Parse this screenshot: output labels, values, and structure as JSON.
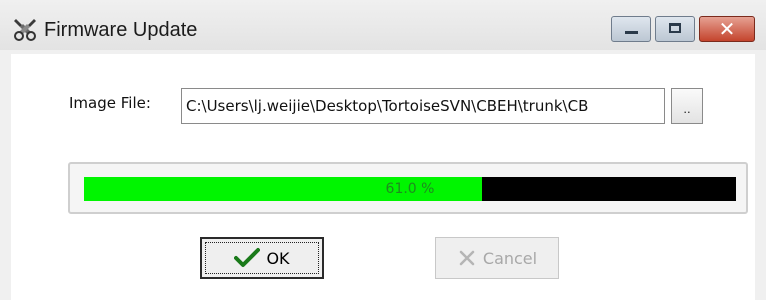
{
  "window": {
    "title": "Firmware Update",
    "icons": {
      "app": "tools-icon",
      "minimize": "minimize-icon",
      "maximize": "maximize-icon",
      "close": "close-icon"
    }
  },
  "form": {
    "image_file_label": "Image File:",
    "image_file_value": "C:\\Users\\lj.weijie\\Desktop\\TortoiseSVN\\CBEH\\trunk\\CB",
    "browse_label": ".."
  },
  "progress": {
    "text": "61.0 %",
    "fraction": 0.61,
    "fill_color": "#00f500",
    "track_color": "#000000"
  },
  "buttons": {
    "ok_label": "OK",
    "ok_icon": "check-icon",
    "cancel_label": "Cancel",
    "cancel_icon": "x-icon"
  }
}
